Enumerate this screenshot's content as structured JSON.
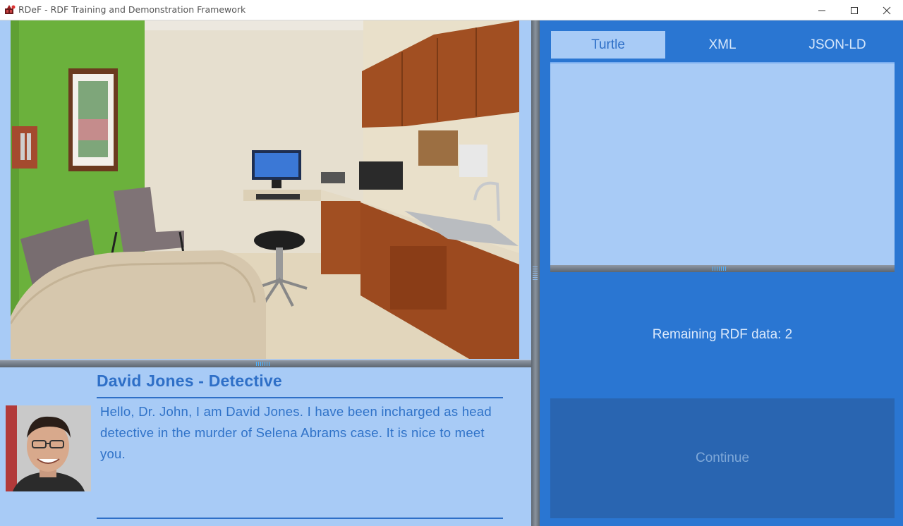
{
  "window": {
    "title": "RDeF - RDF Training and Demonstration Framework",
    "icons": [
      "app-icon",
      "minimize-icon",
      "maximize-icon",
      "close-icon"
    ]
  },
  "scene": {
    "description_icon": "exam-room-photo"
  },
  "dialog": {
    "speaker": "David Jones - Detective",
    "text": "Hello, Dr. John, I am David Jones. I have been incharged as head detective in the murder of Selena Abrams case. It is nice to meet you.",
    "avatar_icon": "avatar-photo"
  },
  "tabs": [
    {
      "label": "Turtle",
      "active": true
    },
    {
      "label": "XML",
      "active": false
    },
    {
      "label": "JSON-LD",
      "active": false
    }
  ],
  "rdf": {
    "content": "",
    "remaining_text": "Remaining RDF data: 2"
  },
  "actions": {
    "continue_label": "Continue",
    "continue_enabled": false
  },
  "colors": {
    "panel_light": "#a8cbf6",
    "panel_dark": "#2a76d2",
    "accent_text": "#2e6fc7"
  }
}
